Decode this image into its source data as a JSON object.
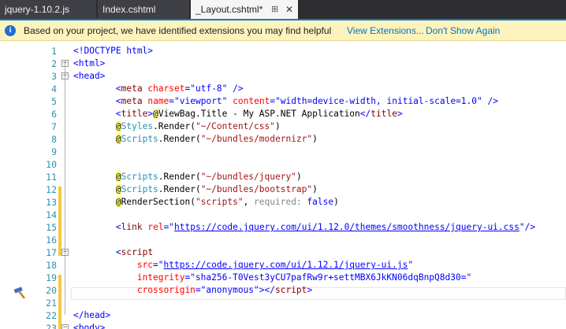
{
  "tabs": [
    {
      "label": "jquery-1.10.2.js"
    },
    {
      "label": "Index.cshtml"
    },
    {
      "label": "_Layout.cshtml*",
      "pin": "⊞",
      "close": "✕"
    }
  ],
  "infobar": {
    "message": "Based on your project, we have identified extensions you may find helpful",
    "view_extensions": "View Extensions...",
    "dont_show": "Don't Show Again"
  },
  "editor": {
    "line_numbers": [
      "1",
      "2",
      "3",
      "4",
      "5",
      "6",
      "7",
      "8",
      "9",
      "10",
      "11",
      "12",
      "13",
      "14",
      "15",
      "16",
      "17",
      "18",
      "19",
      "20",
      "21",
      "22",
      "23"
    ],
    "lines": {
      "l1": "<!DOCTYPE html>",
      "l2": "<html>",
      "l3": "<head>",
      "l4": {
        "open": "<",
        "tag": "meta",
        "attr": "charset",
        "eq": "=",
        "val": "\"utf-8\"",
        "close": " />"
      },
      "l5": {
        "tag": "meta",
        "a1": "name",
        "v1": "\"viewport\"",
        "a2": "content",
        "v2": "\"width=device-width, initial-scale=1.0\""
      },
      "l6": {
        "tag": "title",
        "at": "@",
        "prop": "ViewBag.Title",
        "text": " - My ASP.NET Application"
      },
      "l7": {
        "at": "@",
        "cls": "Styles",
        "method": ".Render(",
        "str": "\"~/Content/css\"",
        "end": ")"
      },
      "l8": {
        "at": "@",
        "cls": "Scripts",
        "method": ".Render(",
        "str": "\"~/bundles/modernizr\"",
        "end": ")"
      },
      "l11": {
        "at": "@",
        "cls": "Scripts",
        "method": ".Render(",
        "str": "\"~/bundles/jquery\"",
        "end": ")"
      },
      "l12": {
        "at": "@",
        "cls": "Scripts",
        "method": ".Render(",
        "str": "\"~/bundles/bootstrap\"",
        "end": ")"
      },
      "l13": {
        "at": "@",
        "method": "RenderSection(",
        "str": "\"scripts\"",
        "sep": ", ",
        "hint": "required:",
        "bool": "false",
        "end": ")"
      },
      "l15": {
        "tag": "link",
        "attr": "rel",
        "url": "https://code.jquery.com/ui/1.12.0/themes/smoothness/jquery-ui.css"
      },
      "l16": {
        "tag": "script"
      },
      "l17": {
        "attr": "src",
        "url": "https://code.jquery.com/ui/1.12.1/jquery-ui.js"
      },
      "l19": {
        "attr": "integrity",
        "val": "\"sha256-T0Vest3yCU7pafRw9r+settMBX6JkKN06dqBnpQ8d30=\""
      },
      "l20": {
        "attr": "crossorigin",
        "val": "\"anonymous\"",
        "tag": "script"
      },
      "l22": "</head>",
      "l23": "<body>"
    }
  },
  "colors": {
    "accent": "#007acc",
    "infobar": "#fcf3bd",
    "line_number": "#2b91af",
    "change_bar": "#f3c846"
  },
  "icons": [
    "info-icon",
    "hammer-icon",
    "pin-icon",
    "close-icon",
    "fold-icon"
  ]
}
